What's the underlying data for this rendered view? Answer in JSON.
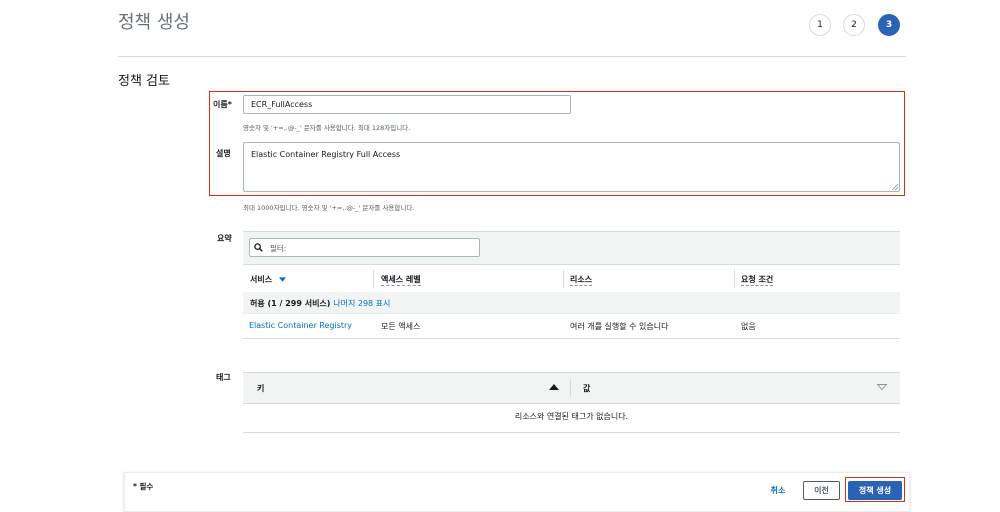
{
  "header": {
    "title": "정책 생성",
    "steps": [
      "1",
      "2",
      "3"
    ],
    "active_step": "3"
  },
  "review": {
    "title": "정책 검토",
    "name_label": "이름*",
    "name_value": "ECR_FullAccess",
    "name_hint": "영숫자 및 '+=,.@-_' 문자를 사용합니다. 최대 128자입니다.",
    "desc_label": "설명",
    "desc_value": "Elastic Container Registry Full Access",
    "desc_hint": "최대 1000자입니다. 영숫자 및 '+=,.@-_' 문자를 사용합니다."
  },
  "summary": {
    "label": "요약",
    "filter_placeholder": "필터:",
    "columns": [
      "서비스",
      "액세스 레벨",
      "리소스",
      "요청 조건"
    ],
    "group_prefix": "허용 (1 / 299 서비스)",
    "group_link": "나머지 298 표시",
    "rows": [
      {
        "service": "Elastic Container Registry",
        "access": "모든 액세스",
        "resource": "여러 개를 실행할 수 있습니다",
        "condition": "없음"
      }
    ]
  },
  "tags": {
    "label": "태그",
    "key_col": "키",
    "value_col": "값",
    "empty_text": "리소스와 연결된 태그가 없습니다."
  },
  "footer": {
    "required_note": "* 필수",
    "cancel_label": "취소",
    "prev_label": "이전",
    "create_label": "정책 생성"
  },
  "colors": {
    "primary": "#2a62b5",
    "link": "#0073bb",
    "highlight": "#d13212"
  }
}
